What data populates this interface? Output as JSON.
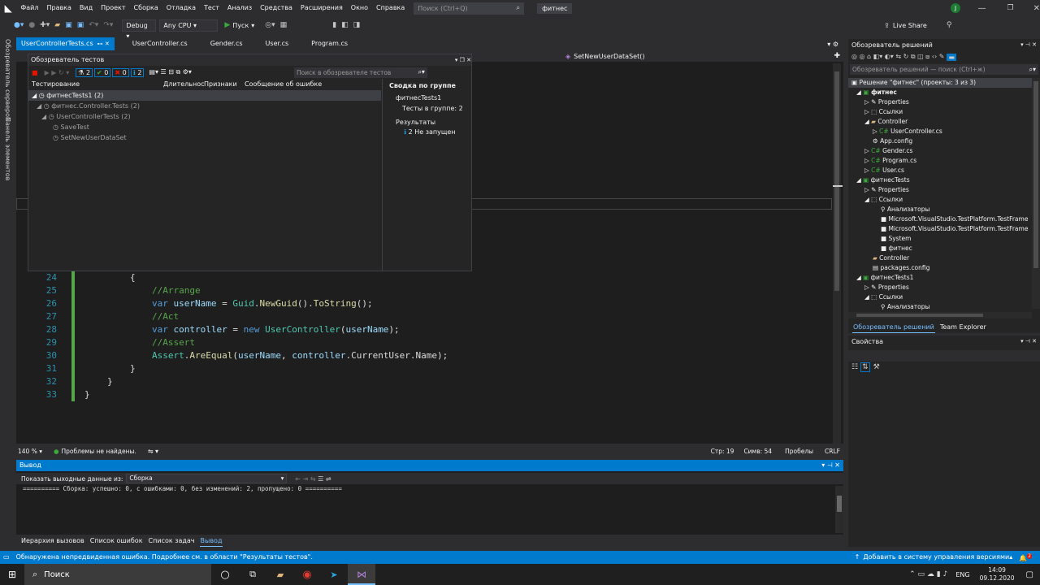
{
  "menu": {
    "items": [
      "Файл",
      "Правка",
      "Вид",
      "Проект",
      "Сборка",
      "Отладка",
      "Тест",
      "Анализ",
      "Средства",
      "Расширения",
      "Окно",
      "Справка"
    ],
    "search_placeholder": "Поиск (Ctrl+Q)",
    "solution_name": "фитнес",
    "user_initial": "J",
    "live_share": "Live Share"
  },
  "toolbar": {
    "config": "Debug",
    "platform": "Any CPU",
    "start_label": "Пуск"
  },
  "left_strip": {
    "server_explorer": "Обозреватель серверов",
    "toolbox": "Панель элементов"
  },
  "doc_tabs": [
    "UserControllerTests.cs",
    "UserController.cs",
    "Gender.cs",
    "User.cs",
    "Program.cs"
  ],
  "nav": {
    "member": "SetNewUserDataSet()"
  },
  "test_explorer": {
    "title": "Обозреватель тестов",
    "badge_all": "2",
    "badge_pass": "0",
    "badge_fail": "0",
    "badge_info": "2",
    "search_placeholder": "Поиск в обозревателе тестов",
    "columns": [
      "Тестирование",
      "Длительнос",
      "Признаки",
      "Сообщение об ошибке"
    ],
    "tree": [
      {
        "label": "фитнесTests1 (2)",
        "level": 0
      },
      {
        "label": "фитнес.Controller.Tests (2)",
        "level": 1
      },
      {
        "label": "UserControllerTests (2)",
        "level": 2
      },
      {
        "label": "SaveTest",
        "level": 3
      },
      {
        "label": "SetNewUserDataSet",
        "level": 3
      }
    ],
    "summary_title": "Сводка по группе",
    "summary_project": "фитнесTests1",
    "summary_tests_label": "Тесты в группе:",
    "summary_tests_count": "2",
    "results_label": "Результаты",
    "results_value": "2 Не запущен"
  },
  "code": {
    "lines": [
      {
        "n": "24",
        "text": "{"
      },
      {
        "n": "25",
        "text": "//Arrange"
      },
      {
        "n": "26",
        "text": "var userName = Guid.NewGuid().ToString();"
      },
      {
        "n": "27",
        "text": "//Act"
      },
      {
        "n": "28",
        "text": "var controller = new UserController(userName);"
      },
      {
        "n": "29",
        "text": "//Assert"
      },
      {
        "n": "30",
        "text": "Assert.AreEqual(userName, controller.CurrentUser.Name);"
      },
      {
        "n": "31",
        "text": "}"
      },
      {
        "n": "32",
        "text": "}"
      },
      {
        "n": "33",
        "text": "}"
      }
    ]
  },
  "editor_status": {
    "zoom": "140 %",
    "issues": "Проблемы не найдены.",
    "line": "Стр: 19",
    "col": "Симв: 54",
    "spaces": "Пробелы",
    "eol": "CRLF"
  },
  "output": {
    "title": "Вывод",
    "show_from_label": "Показать выходные данные из:",
    "source": "Сборка",
    "text": "========== Сборка: успешно: 0, с ошибками: 0, без изменений: 2, пропущено: 0 =========="
  },
  "bottom_tabs": [
    "Иерархия вызовов",
    "Список ошибок",
    "Список задач",
    "Вывод"
  ],
  "solution_explorer": {
    "title": "Обозреватель решений",
    "search_placeholder": "Обозреватель решений — поиск (Ctrl+ж)",
    "items": [
      {
        "label": "Решение \"фитнес\" (проекты: 3 из 3)",
        "level": 0,
        "bold": false
      },
      {
        "label": "фитнес",
        "level": 1,
        "bold": true
      },
      {
        "label": "Properties",
        "level": 2
      },
      {
        "label": "Ссылки",
        "level": 2
      },
      {
        "label": "Controller",
        "level": 2
      },
      {
        "label": "UserController.cs",
        "level": 3
      },
      {
        "label": "App.config",
        "level": 2
      },
      {
        "label": "Gender.cs",
        "level": 2
      },
      {
        "label": "Program.cs",
        "level": 2
      },
      {
        "label": "User.cs",
        "level": 2
      },
      {
        "label": "фитнесTests",
        "level": 1
      },
      {
        "label": "Properties",
        "level": 2
      },
      {
        "label": "Ссылки",
        "level": 2
      },
      {
        "label": "Анализаторы",
        "level": 3
      },
      {
        "label": "Microsoft.VisualStudio.TestPlatform.TestFrame",
        "level": 3
      },
      {
        "label": "Microsoft.VisualStudio.TestPlatform.TestFrame",
        "level": 3
      },
      {
        "label": "System",
        "level": 3
      },
      {
        "label": "фитнес",
        "level": 3
      },
      {
        "label": "Controller",
        "level": 2
      },
      {
        "label": "packages.config",
        "level": 2
      },
      {
        "label": "фитнесTests1",
        "level": 1
      },
      {
        "label": "Properties",
        "level": 2
      },
      {
        "label": "Ссылки",
        "level": 2
      },
      {
        "label": "Анализаторы",
        "level": 3
      }
    ],
    "tab_active": "Обозреватель решений",
    "tab_other": "Team Explorer"
  },
  "properties": {
    "title": "Свойства"
  },
  "vs_status": {
    "message": "Обнаружена непредвиденная ошибка. Подробнее см. в области \"Результаты тестов\".",
    "source_control": "Добавить в систему управления версиями",
    "notifications": "2"
  },
  "taskbar": {
    "search": "Поиск",
    "lang": "ENG",
    "time": "14:09",
    "date": "09.12.2020"
  },
  "colors": {
    "accent": "#007acc",
    "keyword": "#569cd6",
    "comment": "#57a64a",
    "ident": "#9cdcfe",
    "type": "#4ec9b0",
    "method": "#dcdcaa"
  }
}
